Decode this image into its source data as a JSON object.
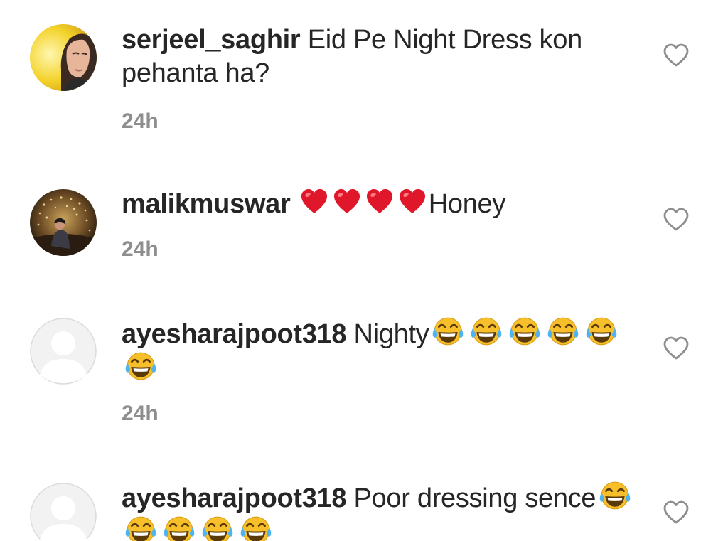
{
  "comments": [
    {
      "username": "serjeel_saghir",
      "text": "Eid Pe Night Dress kon pehanta ha?",
      "time": "24h",
      "avatar": "photo-person-icon",
      "emoji": []
    },
    {
      "username": "malikmuswar",
      "text": "Honey",
      "time": "24h",
      "avatar": "photo-night-lights-icon",
      "emoji": [
        "red-heart",
        "red-heart",
        "red-heart",
        "red-heart"
      ]
    },
    {
      "username": "ayesharajpoot318",
      "text": "Nighty",
      "time": "24h",
      "avatar": "default-user-icon",
      "emoji": [
        "tears-of-joy",
        "tears-of-joy",
        "tears-of-joy",
        "tears-of-joy",
        "tears-of-joy",
        "tears-of-joy"
      ]
    },
    {
      "username": "ayesharajpoot318",
      "text": "Poor dressing sence",
      "time": "",
      "avatar": "default-user-icon",
      "emoji": [
        "tears-of-joy",
        "tears-of-joy",
        "tears-of-joy",
        "tears-of-joy",
        "tears-of-joy"
      ]
    }
  ],
  "colors": {
    "text": "#262626",
    "time": "#8e8e8e",
    "like_icon": "#8e8e8e",
    "heart_emoji": "#e0162b",
    "laugh_emoji": "#f7c02a"
  },
  "icons": {
    "like": "heart-outline-icon"
  }
}
